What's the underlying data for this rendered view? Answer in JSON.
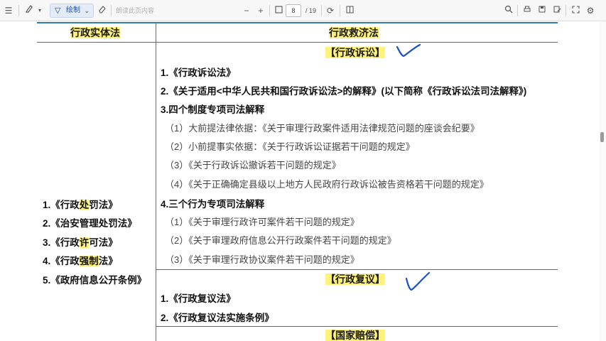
{
  "toolbar": {
    "menu_icon": "menu-icon",
    "highlighter_icon": "highlighter-icon",
    "draw_label": "绘制",
    "eraser_icon": "eraser-icon",
    "search_placeholder": "朗读此页内容",
    "zoom_out": "−",
    "zoom_in": "+",
    "fit_icon": "fit-page-icon",
    "page_current": "8",
    "page_total": "/ 19",
    "rotate_icon": "rotate-icon",
    "view_icon": "page-view-icon",
    "right_icons": [
      "search-icon",
      "print-icon",
      "save-icon",
      "save-as-icon",
      "fullscreen-icon",
      "settings-icon"
    ]
  },
  "table": {
    "col_left_header": "行政实体法",
    "col_right_header": "行政救济法",
    "left_items": [
      {
        "num": "1.",
        "pre": "《行政",
        "hl": "处",
        "post": "罚法》"
      },
      {
        "num": "2.",
        "pre": "《治安管理处罚法》",
        "hl": "",
        "post": ""
      },
      {
        "num": "3.",
        "pre": "《行政",
        "hl": "许",
        "post": "可法》"
      },
      {
        "num": "4.",
        "pre": "《行政",
        "hl": "强制",
        "post": "法》"
      },
      {
        "num": "5.",
        "pre": "《政府信息公开条例》",
        "hl": "",
        "post": ""
      }
    ],
    "litigation": {
      "title": "【行政诉讼】",
      "items": [
        "1.《行政诉讼法》",
        "2.《关于适用<中华人民共和国行政诉讼法>的解释》(以下简称《行政诉讼法司法解释》)",
        "3.四个制度专项司法解释"
      ],
      "sub_a": [
        "（1）大前提法律依据：《关于审理行政案件适用法律规范问题的座谈会纪要》",
        "（2）小前提事实依据：《关于行政诉讼证据若干问题的规定》",
        "（3）《关于行政诉讼撤诉若干问题的规定》",
        "（4）《关于正确确定县级以上地方人民政府行政诉讼被告资格若干问题的规定》"
      ],
      "item4": "4.三个行为专项司法解释",
      "sub_b": [
        "（1）《关于审理行政许可案件若干问题的规定》",
        "（2）《关于审理政府信息公开行政案件若干问题的规定》",
        "（3）《关于审理行政协议案件若干问题的规定》"
      ]
    },
    "reconsideration": {
      "title": "【行政复议】",
      "items": [
        "1.《行政复议法》",
        "2.《行政复议法实施条例》"
      ]
    },
    "compensation": {
      "title": "【国家赔偿】"
    }
  },
  "colors": {
    "table_line": "#2e7fb0",
    "highlight": "#fff27a",
    "checkmark": "#1f4fbf"
  }
}
